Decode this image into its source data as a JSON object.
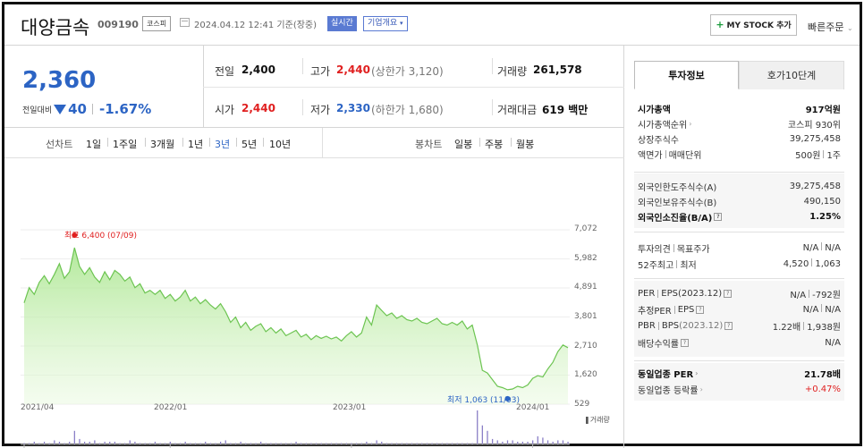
{
  "header": {
    "company": "대양금속",
    "code": "009190",
    "market": "코스피",
    "datetime": "2024.04.12 12:41 기준(장중)",
    "realtime": "실시간",
    "company_info": "기업개요",
    "mystock": "MY STOCK 추가",
    "mystock_plus": "+",
    "quick_order": "빠른주문"
  },
  "quote": {
    "price": "2,360",
    "change_label": "전일대비",
    "change": "40",
    "change_pct": "-1.67%",
    "prev_close_label": "전일",
    "prev_close": "2,400",
    "high_label": "고가",
    "high": "2,440",
    "upper_limit": "(상한가 3,120)",
    "volume_label": "거래량",
    "volume": "261,578",
    "open_label": "시가",
    "open": "2,440",
    "low_label": "저가",
    "low": "2,330",
    "lower_limit": "(하한가 1,680)",
    "amount_label": "거래대금",
    "amount": "619 백만"
  },
  "periods": {
    "line_label": "선차트",
    "line_items": [
      "1일",
      "1주일",
      "3개월",
      "1년",
      "3년",
      "5년",
      "10년"
    ],
    "active": "3년",
    "candle_label": "봉차트",
    "candle_items": [
      "일봉",
      "주봉",
      "월봉"
    ]
  },
  "chart_data": {
    "type": "area",
    "y_ticks": [
      "7,072",
      "5,982",
      "4,891",
      "3,801",
      "2,710",
      "1,620",
      "529"
    ],
    "ylim": [
      529,
      7072
    ],
    "x_ticks": [
      "2021/04",
      "2022/01",
      "2023/01",
      "2024/01"
    ],
    "high_label": "최고 6,400 (07/09)",
    "low_label": "최저 1,063 (11/03)",
    "volume_label": "거래량",
    "series": [
      {
        "values": [
          4330,
          4900,
          4650,
          5100,
          5350,
          5050,
          5400,
          5800,
          5250,
          5500,
          6400,
          5700,
          5400,
          5650,
          5300,
          5100,
          5500,
          5200,
          5550,
          5400,
          5150,
          5300,
          4900,
          5050,
          4700,
          4800,
          4650,
          4800,
          4500,
          4650,
          4400,
          4550,
          4800,
          4400,
          4550,
          4300,
          4450,
          4250,
          4100,
          4300,
          4000,
          3600,
          3800,
          3400,
          3600,
          3300,
          3450,
          3550,
          3250,
          3400,
          3200,
          3350,
          3100,
          3200,
          3300,
          3050,
          3150,
          2950,
          3100,
          3000,
          3080,
          2980,
          3050,
          2900,
          3100,
          3250,
          3050,
          3200,
          3800,
          3500,
          4250,
          4050,
          3850,
          3950,
          3750,
          3850,
          3700,
          3650,
          3750,
          3600,
          3550,
          3650,
          3750,
          3550,
          3500,
          3600,
          3500,
          3650,
          3350,
          3500,
          2750,
          1800,
          1700,
          1450,
          1200,
          1150,
          1070,
          1100,
          1200,
          1150,
          1250,
          1500,
          1600,
          1550,
          1850,
          2100,
          2500,
          2750,
          2650
        ]
      }
    ],
    "volume": [
      1,
      1,
      2,
      1,
      2,
      1,
      3,
      2,
      1,
      2,
      10,
      4,
      2,
      2,
      3,
      1,
      2,
      2,
      2,
      1,
      1,
      3,
      2,
      1,
      1,
      1,
      2,
      1,
      1,
      2,
      1,
      1,
      2,
      1,
      1,
      1,
      2,
      1,
      1,
      2,
      3,
      1,
      1,
      2,
      1,
      1,
      1,
      2,
      1,
      1,
      1,
      1,
      1,
      1,
      2,
      1,
      1,
      1,
      1,
      1,
      1,
      1,
      1,
      1,
      1,
      1,
      1,
      1,
      2,
      1,
      3,
      2,
      1,
      1,
      1,
      1,
      1,
      1,
      1,
      1,
      1,
      1,
      1,
      1,
      1,
      1,
      1,
      1,
      1,
      1,
      25,
      14,
      10,
      4,
      3,
      2,
      3,
      3,
      2,
      2,
      2,
      3,
      6,
      5,
      3,
      2,
      3,
      3,
      2
    ]
  },
  "info": {
    "tab_active": "투자정보",
    "tab_inactive": "호가10단계",
    "market_cap_label": "시가총액",
    "market_cap": "917억원",
    "market_cap_rank_label": "시가총액순위",
    "market_cap_rank": "코스피 930위",
    "listed_shares_label": "상장주식수",
    "listed_shares": "39,275,458",
    "face_value_label": "액면가",
    "trade_unit_label": "매매단위",
    "face_value": "500원",
    "trade_unit": "1주",
    "foreign_limit_label": "외국인한도주식수(A)",
    "foreign_limit": "39,275,458",
    "foreign_held_label": "외국인보유주식수(B)",
    "foreign_held": "490,150",
    "foreign_ratio_label": "외국인소진율(B/A)",
    "foreign_ratio": "1.25%",
    "opinion_label": "투자의견",
    "target_label": "목표주가",
    "opinion": "N/A",
    "target": "N/A",
    "w52_high_label": "52주최고",
    "w52_low_label": "최저",
    "w52_high": "4,520",
    "w52_low": "1,063",
    "per_label": "PER",
    "eps_label": "EPS(2023.12)",
    "per": "N/A",
    "eps": "-792원",
    "est_per_label": "추정PER",
    "est_eps_label": "EPS",
    "est_per": "N/A",
    "est_eps": "N/A",
    "pbr_label": "PBR",
    "bps_label": "BPS",
    "bps_period": "(2023.12)",
    "pbr": "1.22배",
    "bps": "1,938원",
    "dividend_label": "배당수익률",
    "dividend": "N/A",
    "sector_per_label": "동일업종 PER",
    "sector_per": "21.78배",
    "sector_rate_label": "동일업종 등락률",
    "sector_rate": "+0.47%"
  }
}
